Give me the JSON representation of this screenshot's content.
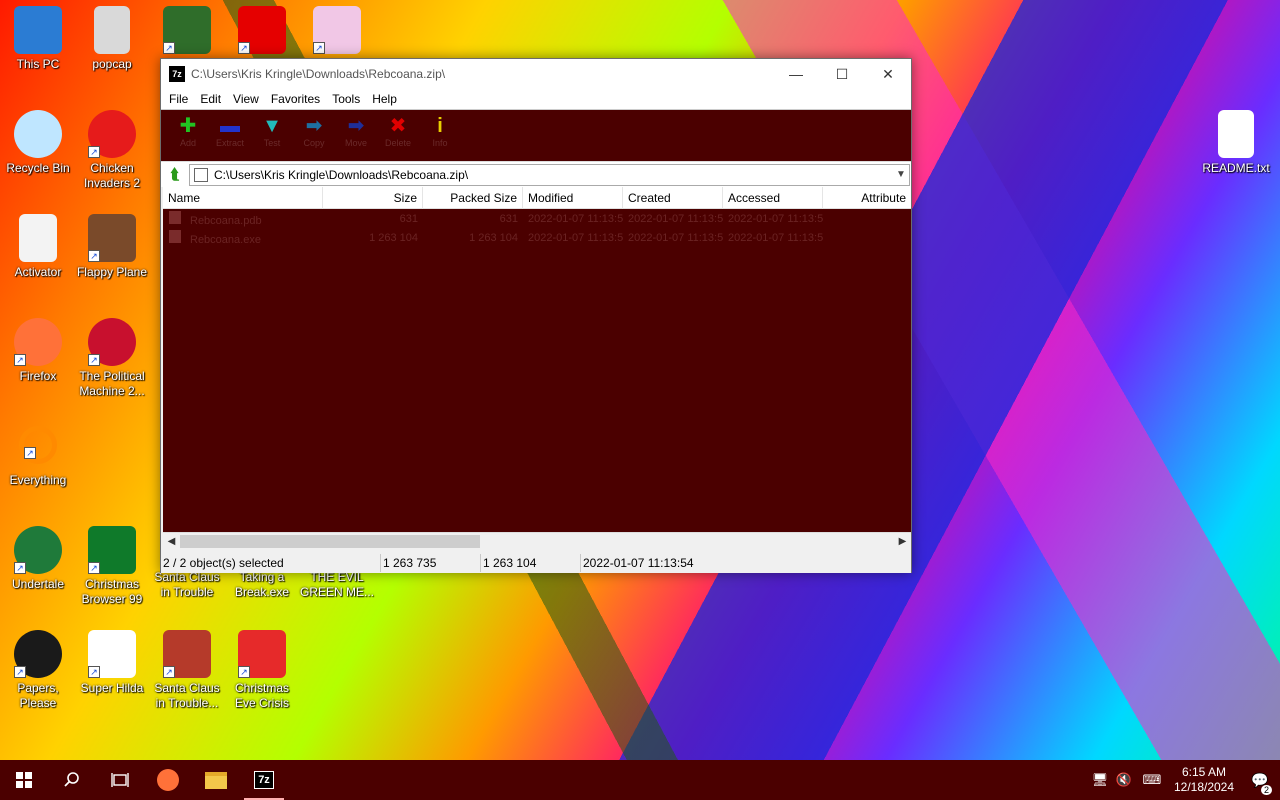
{
  "desktop": {
    "icons": [
      {
        "label": "This PC",
        "icon": "monitor-icon",
        "color": "#2b7cd3"
      },
      {
        "label": "popcap",
        "icon": "folder-icon",
        "color": "#d9d9d9"
      },
      {
        "label": "",
        "icon": "game-character-icon",
        "color": "#2f6d2a"
      },
      {
        "label": "",
        "icon": "mcdonalds-logo-icon",
        "color": "#e50000"
      },
      {
        "label": "",
        "icon": "unicorn-pig-icon",
        "color": "#f1c7e6"
      },
      {
        "label": "Recycle Bin",
        "icon": "recycle-bin-icon",
        "color": "#bfe6ff"
      },
      {
        "label": "Chicken Invaders 2",
        "icon": "chicken-icon",
        "color": "#e61b1b"
      },
      {
        "label": "Activator",
        "icon": "file-icon",
        "color": "#f3f3f3"
      },
      {
        "label": "Flappy Plane",
        "icon": "plane-icon",
        "color": "#7a4a2a"
      },
      {
        "label": "Firefox",
        "icon": "firefox-icon",
        "color": "#ff7139"
      },
      {
        "label": "The Political Machine 2...",
        "icon": "political-2020-icon",
        "color": "#c8102e"
      },
      {
        "label": "Everything",
        "icon": "magnifier-icon",
        "color": "#ff8a00"
      },
      {
        "label": "Undertale",
        "icon": "undertale-icon",
        "color": "#1f7a3a"
      },
      {
        "label": "Christmas Browser 99",
        "icon": "christmas-tree-icon",
        "color": "#0f7a2a"
      },
      {
        "label": "Santa Claus in Trouble",
        "icon": "santa-icon",
        "color": "#c8102e"
      },
      {
        "label": "Taking a Break.exe",
        "icon": "exe-icon",
        "color": "#888888"
      },
      {
        "label": "THE EVIL GREEN ME...",
        "icon": "green-face-icon",
        "color": "#2aa02a"
      },
      {
        "label": "Papers, Please",
        "icon": "papers-please-icon",
        "color": "#1a1a1a"
      },
      {
        "label": "Super Hilda",
        "icon": "pixel-cat-icon",
        "color": "#ffffff"
      },
      {
        "label": "Santa Claus in Trouble...",
        "icon": "santa-icon",
        "color": "#b53a2a"
      },
      {
        "label": "Christmas Eve Crisis",
        "icon": "santa-face-icon",
        "color": "#e62a2a"
      },
      {
        "label": "README.txt",
        "icon": "text-file-icon",
        "color": "#ffffff"
      }
    ]
  },
  "window": {
    "title": "C:\\Users\\Kris Kringle\\Downloads\\Rebcoana.zip\\",
    "app_icon": "7z",
    "menu": [
      "File",
      "Edit",
      "View",
      "Favorites",
      "Tools",
      "Help"
    ],
    "toolbar": [
      {
        "label": "Add",
        "icon": "add-icon",
        "color": "#22c322"
      },
      {
        "label": "Extract",
        "icon": "extract-icon",
        "color": "#2233cc"
      },
      {
        "label": "Test",
        "icon": "test-icon",
        "color": "#22bbbb"
      },
      {
        "label": "Copy",
        "icon": "copy-icon",
        "color": "#1e6fa0"
      },
      {
        "label": "Move",
        "icon": "move-icon",
        "color": "#1f2f9a"
      },
      {
        "label": "Delete",
        "icon": "delete-icon",
        "color": "#e00000"
      },
      {
        "label": "Info",
        "icon": "info-icon",
        "color": "#e8d000"
      }
    ],
    "address": "C:\\Users\\Kris Kringle\\Downloads\\Rebcoana.zip\\",
    "columns": [
      "Name",
      "Size",
      "Packed Size",
      "Modified",
      "Created",
      "Accessed",
      "Attribute"
    ],
    "rows": [
      {
        "name": "Rebcoana.pdb",
        "size": "631",
        "packed": "631",
        "modified": "2022-01-07 11:13:54",
        "created": "2022-01-07 11:13:54",
        "accessed": "2022-01-07 11:13:54"
      },
      {
        "name": "Rebcoana.exe",
        "size": "1 263 104",
        "packed": "1 263 104",
        "modified": "2022-01-07 11:13:54",
        "created": "2022-01-07 11:13:54",
        "accessed": "2022-01-07 11:13:54"
      }
    ],
    "status": {
      "selected": "2 / 2 object(s) selected",
      "size": "1 263 735",
      "packed": "1 263 104",
      "modified": "2022-01-07 11:13:54"
    }
  },
  "taskbar": {
    "time": "6:15 AM",
    "date": "12/18/2024",
    "notification_count": "2"
  }
}
